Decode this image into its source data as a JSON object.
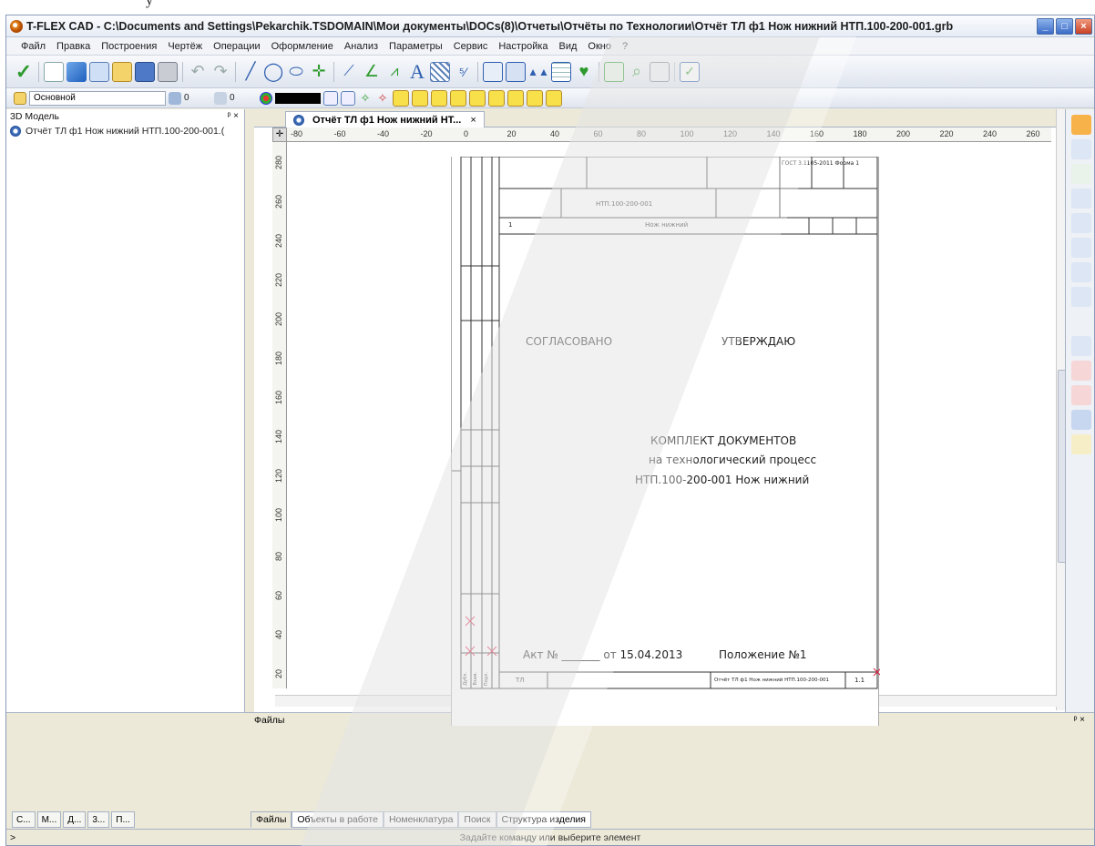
{
  "window": {
    "title": "T-FLEX CAD - C:\\Documents and Settings\\Pekarchik.TSDOMAIN\\Мои документы\\DOCs(8)\\Отчеты\\Отчёты по Технологии\\Отчёт ТЛ ф1 Нож нижний НТП.100-200-001.grb",
    "min": "_",
    "max": "□",
    "close": "×"
  },
  "menu": [
    "Файл",
    "Правка",
    "Построения",
    "Чертёж",
    "Операции",
    "Оформление",
    "Анализ",
    "Параметры",
    "Сервис",
    "Настройка",
    "Вид",
    "Окно",
    "?"
  ],
  "toolbar": {
    "layer": "Основной",
    "field1": "0",
    "field2": "0"
  },
  "left_panel": {
    "title": "3D Модель",
    "pin": "ᵖ ×",
    "tree_item": "Отчёт ТЛ ф1 Нож нижний НТП.100-200-001.("
  },
  "document": {
    "tab_label": "Отчёт ТЛ ф1 Нож нижний НТ...",
    "tab_close": "×",
    "ruler_h": [
      "-80",
      "-60",
      "-40",
      "-20",
      "0",
      "20",
      "40",
      "60",
      "80",
      "100",
      "120",
      "140",
      "160",
      "180",
      "200",
      "220",
      "240",
      "260"
    ],
    "ruler_v": [
      "280",
      "260",
      "240",
      "220",
      "200",
      "180",
      "160",
      "140",
      "120",
      "100",
      "80",
      "60",
      "40",
      "20"
    ]
  },
  "sheet": {
    "gost": "ГОСТ 3.1105-2011 Форма 1",
    "code": "НТП.100-200-001",
    "row_num": "1",
    "part_name": "Нож нижний",
    "agreed": "СОГЛАСОВАНО",
    "approved": "УТВЕРЖДАЮ",
    "line1": "КОМПЛЕКТ ДОКУМЕНТОВ",
    "line2": "на технологический процесс",
    "line3": "НТП.100-200-001 Нож нижний",
    "act": "Акт №  _______  от 15.04.2013",
    "regulation": "Положение №1",
    "footer_left": "ТЛ",
    "footer_right": "Отчёт ТЛ ф1 Нож нижний НТП.100-200-001",
    "footer_page": "1.1",
    "side_labels": [
      "Дубл.",
      "Взам.",
      "Подл."
    ]
  },
  "bottom": {
    "files_title": "Файлы",
    "left_tabs": [
      "С...",
      "М...",
      "Д...",
      "3...",
      "П..."
    ],
    "file_tabs": [
      "Файлы",
      "Объекты в работе",
      "Номенклатура",
      "Поиск",
      "Структура изделия"
    ]
  },
  "status": {
    "prompt": ">",
    "message": "Задайте команду или выберите элемент"
  },
  "colors": {
    "watermark": "#e8e8e8",
    "accent": "#3b6cc7"
  }
}
